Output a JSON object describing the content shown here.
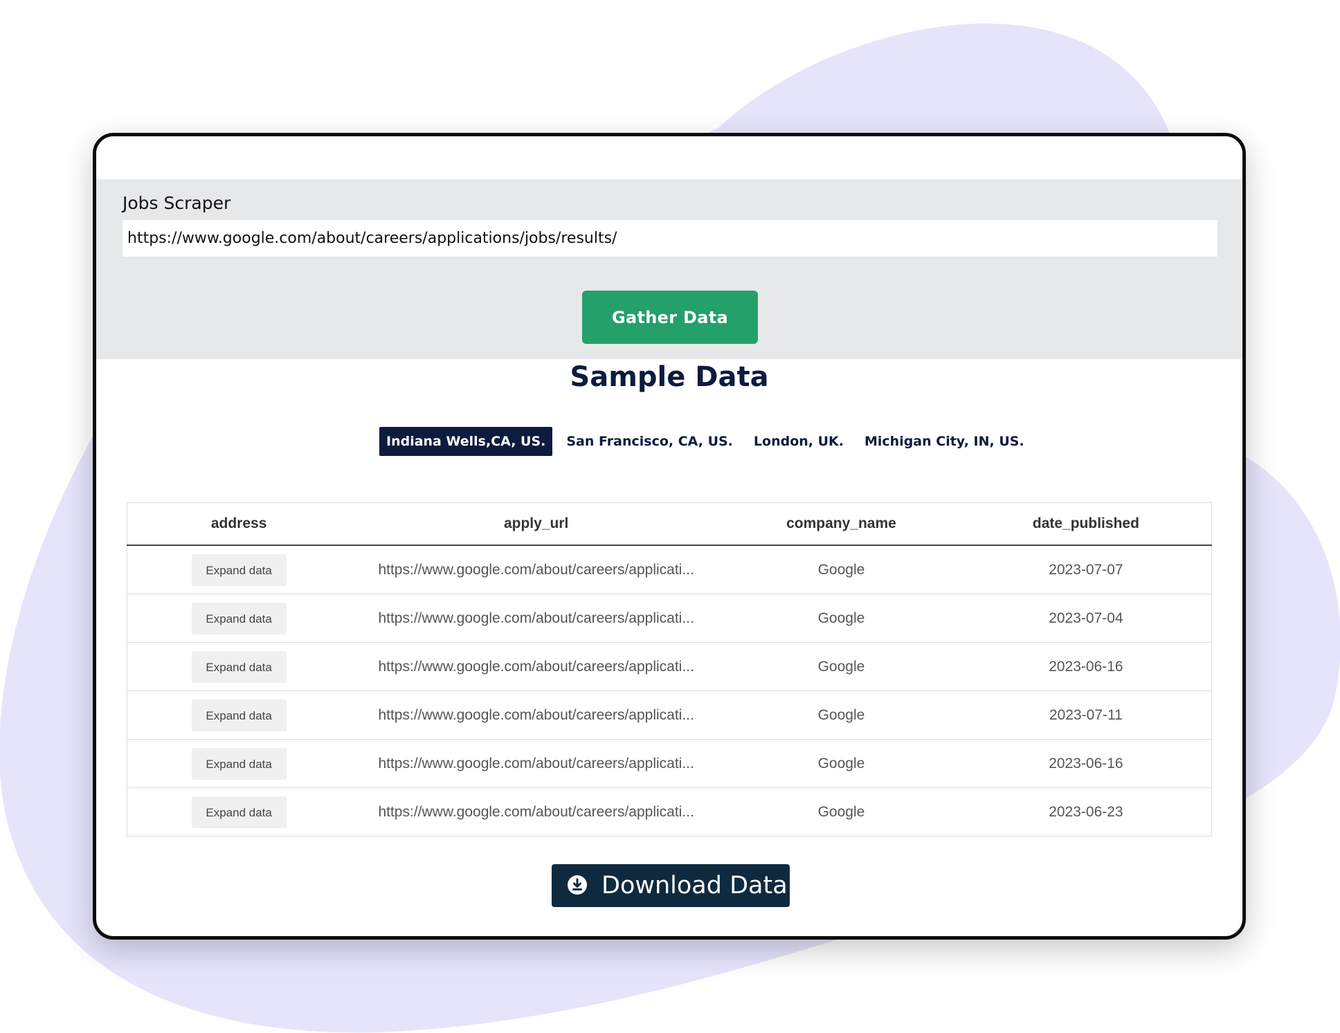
{
  "form": {
    "label": "Jobs Scraper",
    "url_value": "https://www.google.com/about/careers/applications/jobs/results/",
    "gather_label": "Gather Data"
  },
  "sample": {
    "title": "Sample Data",
    "locations": [
      "Indiana Wells,CA, US.",
      "San Francisco, CA, US.",
      "London, UK.",
      "Michigan City, IN, US."
    ],
    "active_location": "Indiana Wells,CA, US."
  },
  "table": {
    "columns": [
      "address",
      "apply_url",
      "company_name",
      "date_published"
    ],
    "rows": [
      {
        "address": "Expand data",
        "apply_url": "https://www.google.com/about/careers/applicati...",
        "company_name": "Google",
        "date_published": "2023-07-07"
      },
      {
        "address": "Expand data",
        "apply_url": "https://www.google.com/about/careers/applicati...",
        "company_name": "Google",
        "date_published": "2023-07-04"
      },
      {
        "address": "Expand data",
        "apply_url": "https://www.google.com/about/careers/applicati...",
        "company_name": "Google",
        "date_published": "2023-06-16"
      },
      {
        "address": "Expand data",
        "apply_url": "https://www.google.com/about/careers/applicati...",
        "company_name": "Google",
        "date_published": "2023-07-11"
      },
      {
        "address": "Expand data",
        "apply_url": "https://www.google.com/about/careers/applicati...",
        "company_name": "Google",
        "date_published": "2023-06-16"
      },
      {
        "address": "Expand data",
        "apply_url": "https://www.google.com/about/careers/applicati...",
        "company_name": "Google",
        "date_published": "2023-06-23"
      }
    ]
  },
  "download": {
    "label": "Download Data",
    "icon": "download-icon"
  },
  "colors": {
    "accent_green": "#24a06a",
    "navy": "#0d1b3e",
    "download_bg": "#0f2a3e",
    "blob": "#e6e4fb",
    "panel_gray": "#e7e8ea"
  }
}
